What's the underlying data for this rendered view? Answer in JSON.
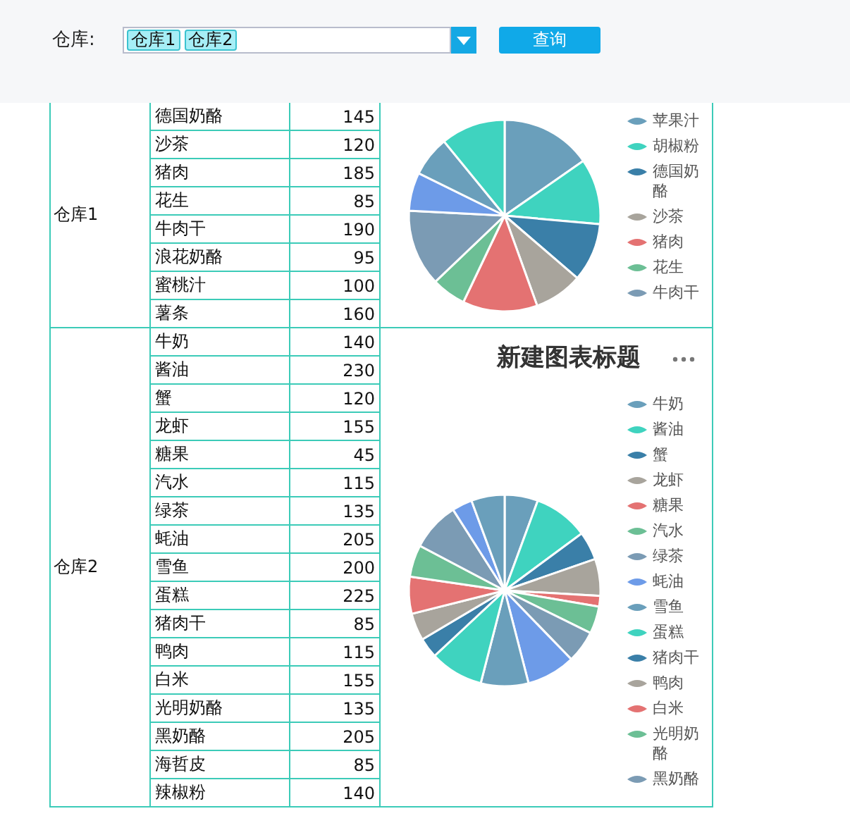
{
  "filter": {
    "label": "仓库:",
    "tags": [
      "仓库1",
      "仓库2"
    ],
    "button": "查询"
  },
  "groups": [
    {
      "name": "仓库1",
      "rows": [
        {
          "item": "德国奶酪",
          "value": "145"
        },
        {
          "item": "沙茶",
          "value": "120"
        },
        {
          "item": "猪肉",
          "value": "185"
        },
        {
          "item": "花生",
          "value": "85"
        },
        {
          "item": "牛肉干",
          "value": "190"
        },
        {
          "item": "浪花奶酪",
          "value": "95"
        },
        {
          "item": "蜜桃汁",
          "value": "100"
        },
        {
          "item": "薯条",
          "value": "160"
        }
      ],
      "chart": {
        "legend": [
          {
            "label": "苹果汁",
            "color": "#6a9fbb"
          },
          {
            "label": "胡椒粉",
            "color": "#3fd3bf"
          },
          {
            "label": "德国奶酪",
            "color": "#3a7fa8"
          },
          {
            "label": "沙茶",
            "color": "#a8a49c"
          },
          {
            "label": "猪肉",
            "color": "#e47272"
          },
          {
            "label": "花生",
            "color": "#6cbf95"
          },
          {
            "label": "牛肉干",
            "color": "#7b9bb4"
          }
        ]
      }
    },
    {
      "name": "仓库2",
      "rows": [
        {
          "item": "牛奶",
          "value": "140"
        },
        {
          "item": "酱油",
          "value": "230"
        },
        {
          "item": "蟹",
          "value": "120"
        },
        {
          "item": "龙虾",
          "value": "155"
        },
        {
          "item": "糖果",
          "value": "45"
        },
        {
          "item": "汽水",
          "value": "115"
        },
        {
          "item": "绿茶",
          "value": "135"
        },
        {
          "item": "蚝油",
          "value": "205"
        },
        {
          "item": "雪鱼",
          "value": "200"
        },
        {
          "item": "蛋糕",
          "value": "225"
        },
        {
          "item": "猪肉干",
          "value": "85"
        },
        {
          "item": "鸭肉",
          "value": "115"
        },
        {
          "item": "白米",
          "value": "155"
        },
        {
          "item": "光明奶酪",
          "value": "135"
        },
        {
          "item": "黑奶酪",
          "value": "205"
        },
        {
          "item": "海哲皮",
          "value": "85"
        },
        {
          "item": "辣椒粉",
          "value": "140"
        }
      ],
      "chart": {
        "title": "新建图表标题",
        "legend": [
          {
            "label": "牛奶",
            "color": "#6a9fbb"
          },
          {
            "label": "酱油",
            "color": "#3fd3bf"
          },
          {
            "label": "蟹",
            "color": "#3a7fa8"
          },
          {
            "label": "龙虾",
            "color": "#a8a49c"
          },
          {
            "label": "糖果",
            "color": "#e47272"
          },
          {
            "label": "汽水",
            "color": "#6cbf95"
          },
          {
            "label": "绿茶",
            "color": "#7b9bb4"
          },
          {
            "label": "蚝油",
            "color": "#6d9be8"
          },
          {
            "label": "雪鱼",
            "color": "#6a9fbb"
          },
          {
            "label": "蛋糕",
            "color": "#3fd3bf"
          },
          {
            "label": "猪肉干",
            "color": "#3a7fa8"
          },
          {
            "label": "鸭肉",
            "color": "#a8a49c"
          },
          {
            "label": "白米",
            "color": "#e47272"
          },
          {
            "label": "光明奶酪",
            "color": "#6cbf95"
          },
          {
            "label": "黑奶酪",
            "color": "#7b9bb4"
          }
        ]
      }
    }
  ]
}
